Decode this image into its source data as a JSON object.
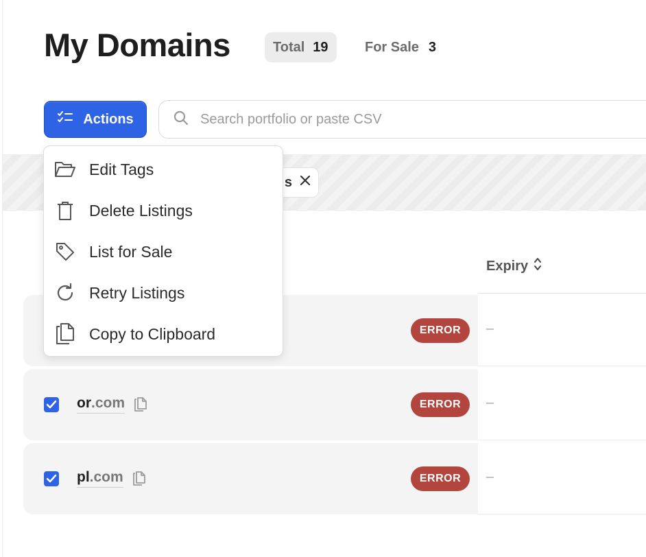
{
  "header": {
    "title": "My Domains",
    "total_label": "Total",
    "total_value": "19",
    "for_sale_label": "For Sale",
    "for_sale_value": "3"
  },
  "toolbar": {
    "actions_label": "Actions",
    "search_placeholder": "Search portfolio or paste CSV"
  },
  "filter": {
    "chip_visible_text": "s"
  },
  "table": {
    "columns": [
      {
        "label": "Expiry"
      }
    ]
  },
  "rows": [
    {
      "name": "",
      "tld": "",
      "checked": true,
      "status": "ERROR",
      "expiry": "–"
    },
    {
      "name": "or",
      "tld": ".com",
      "checked": true,
      "status": "ERROR",
      "expiry": "–"
    },
    {
      "name": "pl",
      "tld": ".com",
      "checked": true,
      "status": "ERROR",
      "expiry": "–"
    }
  ],
  "actions_menu": {
    "items": [
      {
        "label": "Edit Tags",
        "icon": "folder-open-icon"
      },
      {
        "label": "Delete Listings",
        "icon": "trash-icon"
      },
      {
        "label": "List for Sale",
        "icon": "tag-icon"
      },
      {
        "label": "Retry Listings",
        "icon": "refresh-icon"
      },
      {
        "label": "Copy to Clipboard",
        "icon": "copy-icon"
      }
    ]
  },
  "colors": {
    "accent": "#2f63e6",
    "error": "#b2463f"
  }
}
